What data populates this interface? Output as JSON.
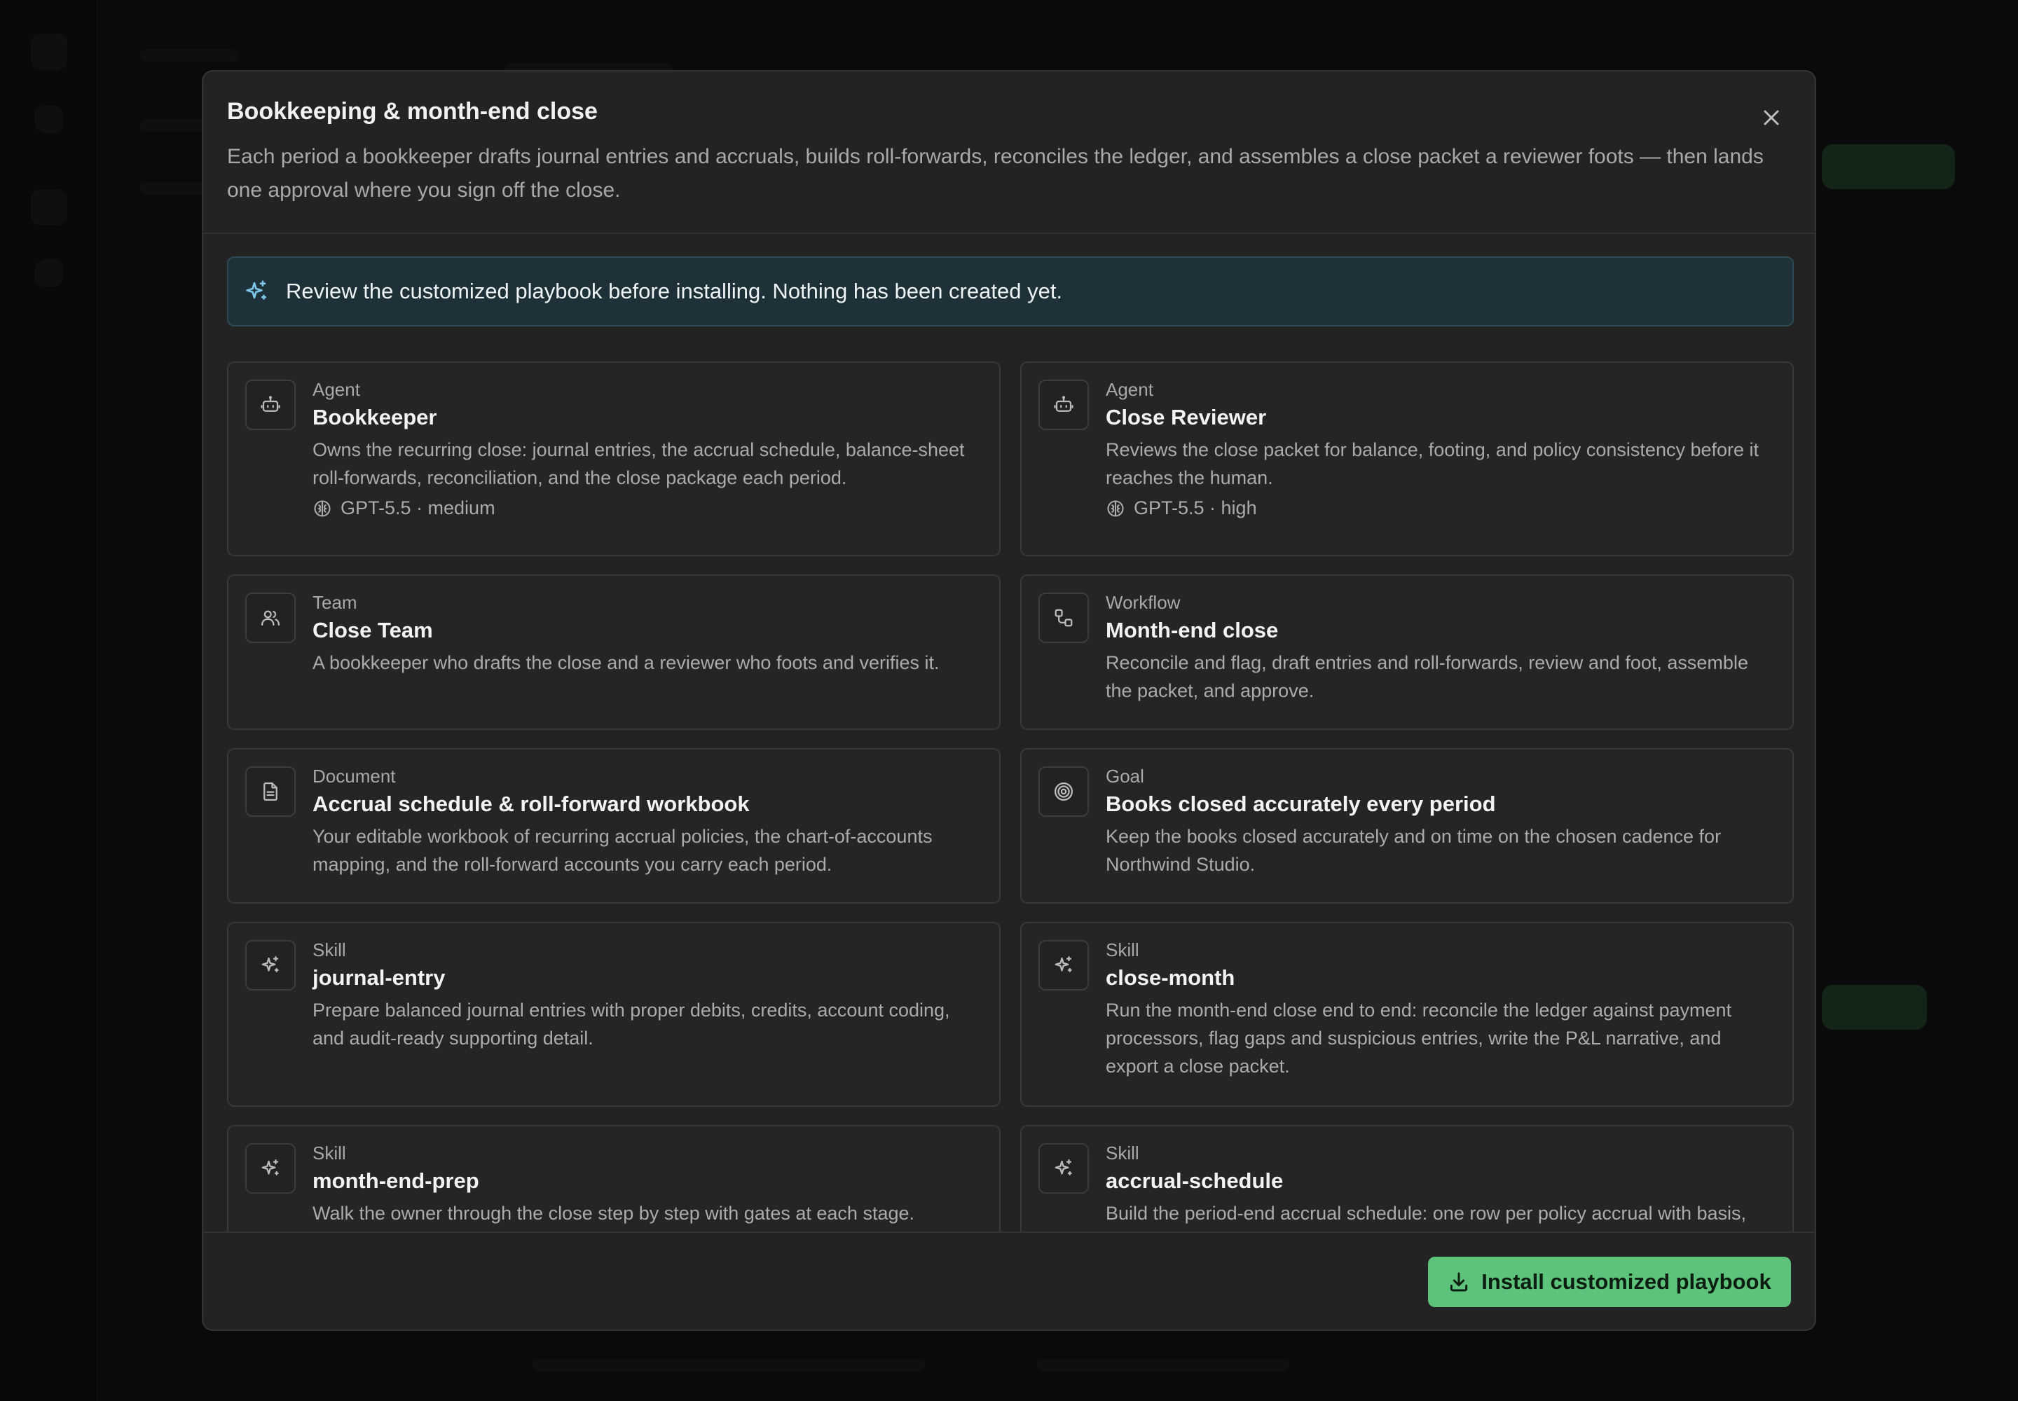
{
  "modal": {
    "title": "Bookkeeping & month-end close",
    "description": "Each period a bookkeeper drafts journal entries and accruals, builds roll-forwards, reconciles the ledger, and assembles a close packet a reviewer foots — then lands one approval where you sign off the close."
  },
  "notice": {
    "icon": "sparkle-icon",
    "text": "Review the customized playbook before installing. Nothing has been created yet."
  },
  "items": [
    {
      "kind": "Agent",
      "name": "Bookkeeper",
      "icon": "bot-icon",
      "description": "Owns the recurring close: journal entries, the accrual schedule, balance-sheet roll-forwards, reconciliation, and the close package each period.",
      "meta": "GPT-5.5 · medium"
    },
    {
      "kind": "Agent",
      "name": "Close Reviewer",
      "icon": "bot-icon",
      "description": "Reviews the close packet for balance, footing, and policy consistency before it reaches the human.",
      "meta": "GPT-5.5 · high"
    },
    {
      "kind": "Team",
      "name": "Close Team",
      "icon": "users-icon",
      "description": "A bookkeeper who drafts the close and a reviewer who foots and verifies it."
    },
    {
      "kind": "Workflow",
      "name": "Month-end close",
      "icon": "workflow-icon",
      "description": "Reconcile and flag, draft entries and roll-forwards, review and foot, assemble the packet, and approve."
    },
    {
      "kind": "Document",
      "name": "Accrual schedule & roll-forward workbook",
      "icon": "document-icon",
      "description": "Your editable workbook of recurring accrual policies, the chart-of-accounts mapping, and the roll-forward accounts you carry each period."
    },
    {
      "kind": "Goal",
      "name": "Books closed accurately every period",
      "icon": "target-icon",
      "description": "Keep the books closed accurately and on time on the chosen cadence for Northwind Studio."
    },
    {
      "kind": "Skill",
      "name": "journal-entry",
      "icon": "sparkle-icon",
      "description": "Prepare balanced journal entries with proper debits, credits, account coding, and audit-ready supporting detail."
    },
    {
      "kind": "Skill",
      "name": "close-month",
      "icon": "sparkle-icon",
      "description": "Run the month-end close end to end: reconcile the ledger against payment processors, flag gaps and suspicious entries, write the P&L narrative, and export a close packet."
    },
    {
      "kind": "Skill",
      "name": "month-end-prep",
      "icon": "sparkle-icon",
      "description": "Walk the owner through the close step by step with gates at each stage."
    },
    {
      "kind": "Skill",
      "name": "accrual-schedule",
      "icon": "sparkle-icon",
      "description": "Build the period-end accrual schedule: one row per policy accrual with basis,"
    }
  ],
  "footer": {
    "install_label": "Install customized playbook",
    "install_icon": "download-icon"
  },
  "colors": {
    "accent": "#5dc27a",
    "notice_bg": "#1e3038",
    "sparkle": "#7cc6ea"
  }
}
